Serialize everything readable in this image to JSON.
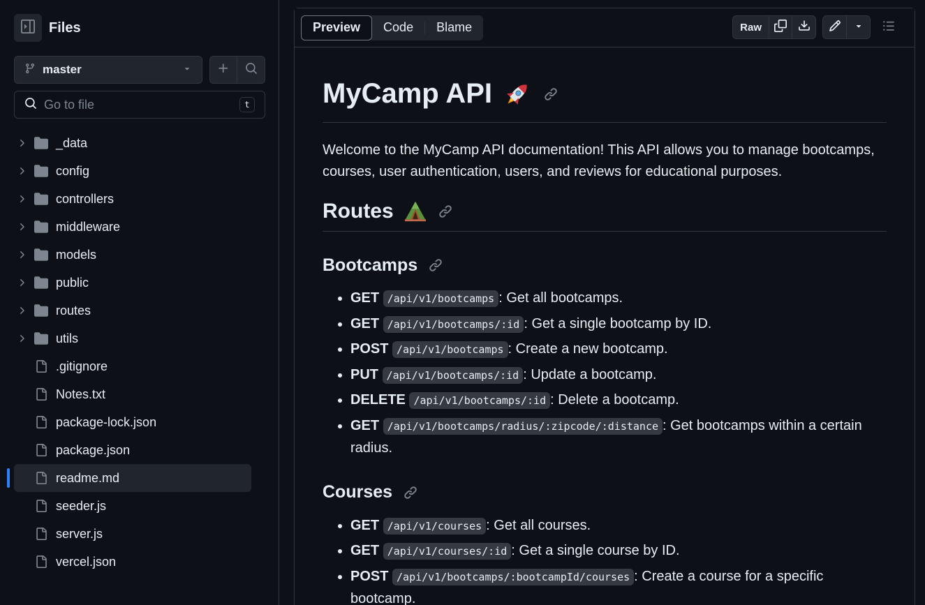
{
  "sidebar": {
    "title": "Files",
    "branch": "master",
    "search_placeholder": "Go to file",
    "search_shortcut": "t",
    "items": [
      {
        "label": "_data",
        "type": "folder"
      },
      {
        "label": "config",
        "type": "folder"
      },
      {
        "label": "controllers",
        "type": "folder"
      },
      {
        "label": "middleware",
        "type": "folder"
      },
      {
        "label": "models",
        "type": "folder"
      },
      {
        "label": "public",
        "type": "folder"
      },
      {
        "label": "routes",
        "type": "folder"
      },
      {
        "label": "utils",
        "type": "folder"
      },
      {
        "label": ".gitignore",
        "type": "file"
      },
      {
        "label": "Notes.txt",
        "type": "file"
      },
      {
        "label": "package-lock.json",
        "type": "file"
      },
      {
        "label": "package.json",
        "type": "file"
      },
      {
        "label": "readme.md",
        "type": "file",
        "selected": true
      },
      {
        "label": "seeder.js",
        "type": "file"
      },
      {
        "label": "server.js",
        "type": "file"
      },
      {
        "label": "vercel.json",
        "type": "file"
      }
    ]
  },
  "toolbar": {
    "tabs": [
      "Preview",
      "Code",
      "Blame"
    ],
    "active_tab": "Preview",
    "raw_label": "Raw"
  },
  "doc": {
    "title": "MyCamp API",
    "title_emoji": "🚀",
    "intro": "Welcome to the MyCamp API documentation! This API allows you to manage bootcamps, courses, user authentication, users, and reviews for educational purposes.",
    "routes_heading": "Routes",
    "routes_emoji": "🏕",
    "sections": [
      {
        "heading": "Bootcamps",
        "items": [
          {
            "method": "GET",
            "path": "/api/v1/bootcamps",
            "desc": ": Get all bootcamps."
          },
          {
            "method": "GET",
            "path": "/api/v1/bootcamps/:id",
            "desc": ": Get a single bootcamp by ID."
          },
          {
            "method": "POST",
            "path": "/api/v1/bootcamps",
            "desc": ": Create a new bootcamp."
          },
          {
            "method": "PUT",
            "path": "/api/v1/bootcamps/:id",
            "desc": ": Update a bootcamp."
          },
          {
            "method": "DELETE",
            "path": "/api/v1/bootcamps/:id",
            "desc": ": Delete a bootcamp."
          },
          {
            "method": "GET",
            "path": "/api/v1/bootcamps/radius/:zipcode/:distance",
            "desc": ": Get bootcamps within a certain radius."
          }
        ]
      },
      {
        "heading": "Courses",
        "items": [
          {
            "method": "GET",
            "path": "/api/v1/courses",
            "desc": ": Get all courses."
          },
          {
            "method": "GET",
            "path": "/api/v1/courses/:id",
            "desc": ": Get a single course by ID."
          },
          {
            "method": "POST",
            "path": "/api/v1/bootcamps/:bootcampId/courses",
            "desc": ": Create a course for a specific bootcamp."
          }
        ]
      }
    ]
  },
  "colors": {
    "background": "#0d1117",
    "border": "#30363d",
    "button_bg": "#21262d",
    "text": "#e6edf3",
    "muted": "#7d8590",
    "accent": "#2f81f7",
    "code_bg": "#343942"
  }
}
